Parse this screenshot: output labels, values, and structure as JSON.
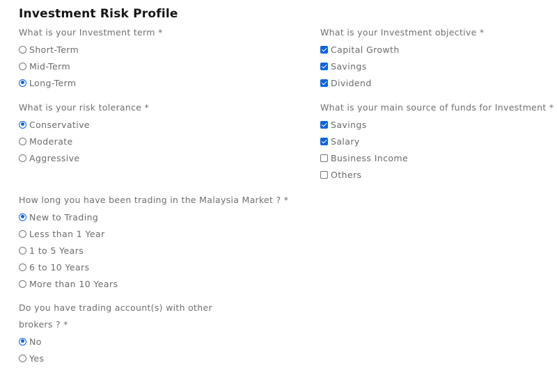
{
  "page": {
    "title": "Investment Risk Profile"
  },
  "colors": {
    "accent": "#0b63e5",
    "title": "#151515",
    "text": "#6b6b6b"
  },
  "investment_term": {
    "question": "What is your Investment term *",
    "options": [
      {
        "label": "Short-Term",
        "selected": false
      },
      {
        "label": "Mid-Term",
        "selected": false
      },
      {
        "label": "Long-Term",
        "selected": true
      }
    ]
  },
  "investment_objective": {
    "question": "What is your Investment objective *",
    "options": [
      {
        "label": "Capital Growth",
        "checked": true
      },
      {
        "label": "Savings",
        "checked": true
      },
      {
        "label": "Dividend",
        "checked": true
      }
    ]
  },
  "risk_tolerance": {
    "question": "What is your risk tolerance *",
    "options": [
      {
        "label": "Conservative",
        "selected": true
      },
      {
        "label": "Moderate",
        "selected": false
      },
      {
        "label": "Aggressive",
        "selected": false
      }
    ]
  },
  "source_of_funds": {
    "question": "What is your main source of funds for Investment *",
    "options": [
      {
        "label": "Savings",
        "checked": true
      },
      {
        "label": "Salary",
        "checked": true
      },
      {
        "label": "Business Income",
        "checked": false
      },
      {
        "label": "Others",
        "checked": false
      }
    ]
  },
  "trading_experience": {
    "question": "How long you have been trading in the Malaysia Market ? *",
    "options": [
      {
        "label": "New to Trading",
        "selected": true
      },
      {
        "label": "Less than 1 Year",
        "selected": false
      },
      {
        "label": "1 to 5 Years",
        "selected": false
      },
      {
        "label": "6 to 10 Years",
        "selected": false
      },
      {
        "label": "More than 10 Years",
        "selected": false
      }
    ]
  },
  "other_brokers": {
    "question_line1": "Do you have trading account(s) with other",
    "question_line2": "brokers ? *",
    "options": [
      {
        "label": "No",
        "selected": true
      },
      {
        "label": "Yes",
        "selected": false
      }
    ]
  }
}
